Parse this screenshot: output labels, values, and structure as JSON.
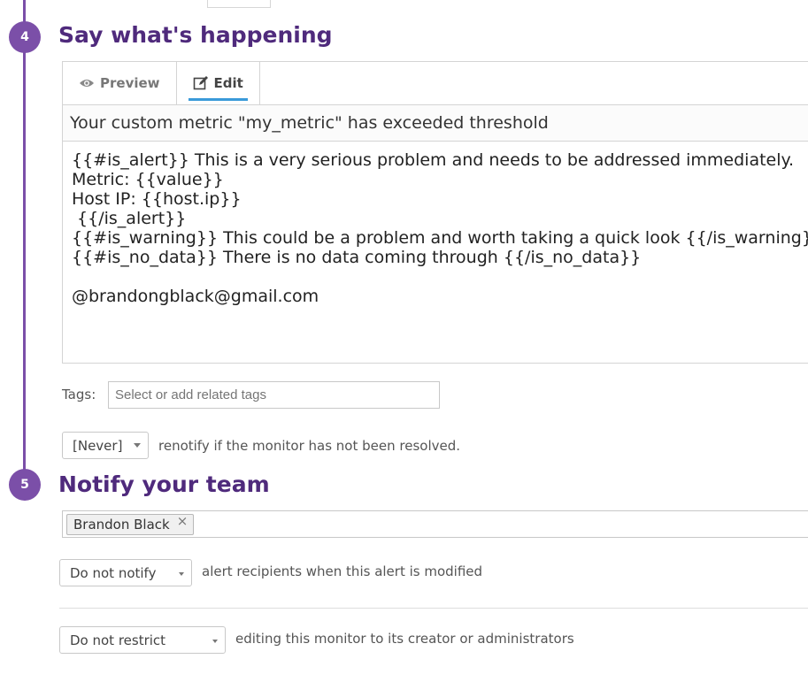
{
  "steps": [
    {
      "number": "4",
      "title": "Say what's happening"
    },
    {
      "number": "5",
      "title": "Notify your team"
    }
  ],
  "editor": {
    "tabs": [
      {
        "label": "Preview",
        "icon": "eye-icon"
      },
      {
        "label": "Edit",
        "icon": "edit-icon"
      }
    ],
    "active_tab": "Edit",
    "title_value": "Your custom metric \"my_metric\" has exceeded threshold",
    "body_lines": [
      "{{#is_alert}} This is a very serious problem and needs to be addressed immediately.",
      "Metric: {{value}}",
      "Host IP: {{host.ip}}",
      " {{/is_alert}}",
      "{{#is_warning}} This could be a problem and worth taking a quick look {{/is_warning}}",
      "{{#is_no_data}} There is no data coming through {{/is_no_data}}",
      "",
      "@brandongblack@gmail.com"
    ]
  },
  "tags": {
    "label": "Tags:",
    "placeholder": "Select or add related tags"
  },
  "renotify": {
    "selected": "[Never]",
    "text": "renotify if the monitor has not been resolved."
  },
  "recipients": [
    {
      "name": "Brandon Black",
      "remove_glyph": "×"
    }
  ],
  "notify_modified": {
    "selected": "Do not notify",
    "text": "alert recipients when this alert is modified"
  },
  "restrict": {
    "selected": "Do not restrict",
    "text": "editing this monitor to its creator or administrators"
  },
  "colors": {
    "accent_purple": "#7b4fa8",
    "title_purple": "#4f2a7c",
    "tab_underline": "#3a9ad9"
  }
}
